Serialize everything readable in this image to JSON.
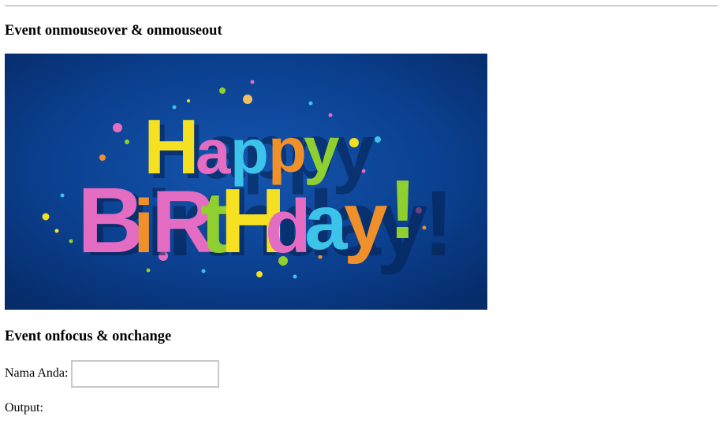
{
  "section_mouse": {
    "heading": "Event onmouseover & onmouseout"
  },
  "banner": {
    "word_top": "Happy",
    "word_bottom": "Birthday!",
    "image_name": "happy-birthday-banner",
    "colors": {
      "background": "#0a3a86",
      "yellow": "#f5e021",
      "pink": "#e46cc2",
      "cyan": "#3cc3ea",
      "green": "#8fcf2f",
      "orange": "#f0902b"
    }
  },
  "section_focus": {
    "heading": "Event onfocus & onchange",
    "name_label": "Nama Anda:",
    "name_input_value": "",
    "output_label": "Output:",
    "output_value": ""
  }
}
